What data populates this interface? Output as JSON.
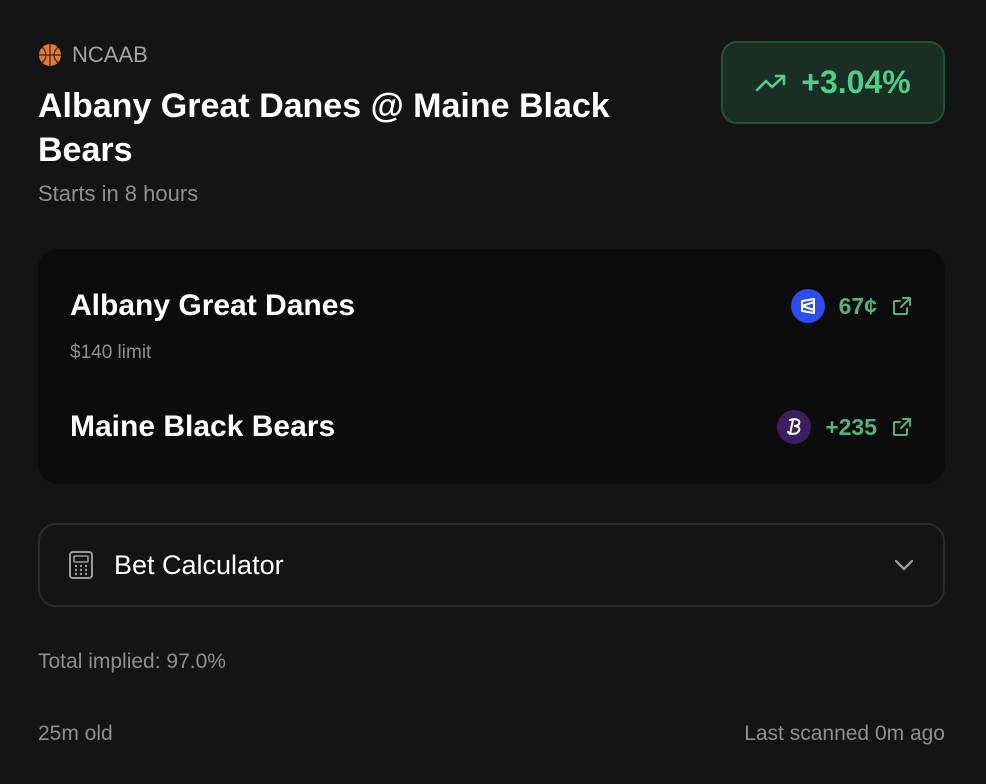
{
  "header": {
    "league": "NCAAB",
    "league_icon": "basketball-icon",
    "title": "Albany Great Danes @ Maine Black Bears",
    "start_status": "Starts in 8 hours"
  },
  "profit_badge": {
    "icon": "trending-up-icon",
    "value": "+3.04%",
    "color": "#4fce8a"
  },
  "odds_card": {
    "teams": [
      {
        "name": "Albany Great Danes",
        "limit": "$140 limit",
        "book_icon": "kalshi-logo",
        "odds": "67¢",
        "link_icon": "external-link-icon"
      },
      {
        "name": "Maine Black Bears",
        "book_icon": "ballybet-logo",
        "odds": "+235",
        "link_icon": "external-link-icon"
      }
    ]
  },
  "calculator": {
    "icon": "calculator-icon",
    "label": "Bet Calculator",
    "toggle_icon": "chevron-down-icon"
  },
  "footer": {
    "total_implied": "Total implied: 97.0%",
    "age": "25m old",
    "last_scanned": "Last scanned 0m ago"
  }
}
